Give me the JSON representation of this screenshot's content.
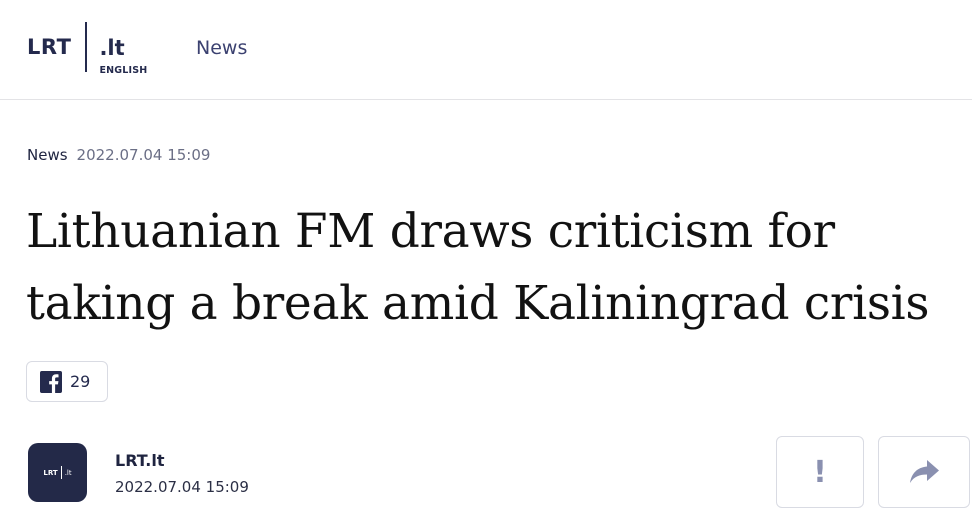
{
  "header": {
    "logo": {
      "brand": "LRT",
      "domain": ".lt",
      "edition": "ENGLISH"
    },
    "nav": {
      "news_label": "News"
    }
  },
  "article": {
    "category": "News",
    "date": "2022.07.04 15:09",
    "title": "Lithuanian FM draws criticism for taking a break amid Kaliningrad crisis",
    "facebook_share_count": "29",
    "author": {
      "name": "LRT.lt",
      "date": "2022.07.04 15:09",
      "avatar": {
        "brand": "LRT",
        "domain": ".lt"
      }
    },
    "actions": {
      "report_glyph": "!",
      "report_icon": "exclamation-icon",
      "share_icon": "share-arrow-icon"
    }
  },
  "colors": {
    "brand_navy": "#242a4d",
    "facebook_icon": "#242a4d",
    "action_icon": "#8a90b0"
  }
}
